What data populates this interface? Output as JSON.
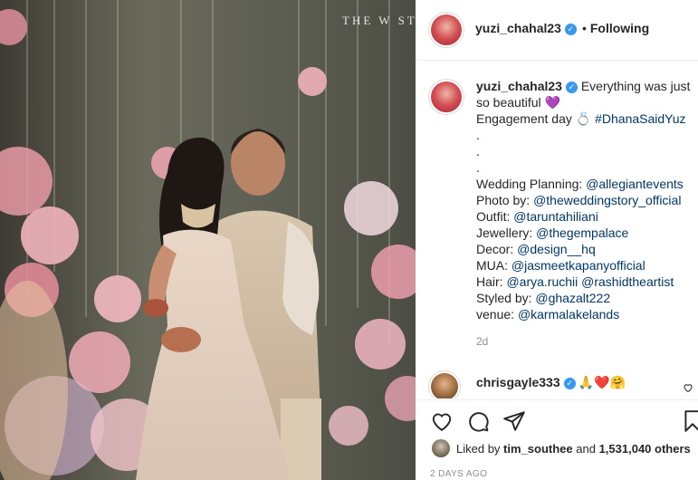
{
  "header": {
    "username": "yuzi_chahal23",
    "follow_label": "Following"
  },
  "watermark": "THE W ST",
  "caption": {
    "username": "yuzi_chahal23",
    "lines": [
      "Everything was just",
      "so beautiful 💜",
      "Engagement day 💍 #DhanaSaidYuz",
      ".",
      ".",
      ".",
      "Wedding Planning: @allegiantevents",
      "Photo by: @theweddingstory_official",
      "Outfit: @taruntahiliani",
      "Jewellery: @thegempalace",
      "Decor: @design__hq",
      "MUA: @jasmeetkapanyofficial",
      "Hair: @arya.ruchii @rashidtheartist",
      "Styled by: @ghazalt222",
      "venue: @karmalakelands"
    ],
    "time_ago": "2d"
  },
  "comment": {
    "username": "chrisgayle333",
    "emojis": "🙏❤️🤗"
  },
  "likes": {
    "prefix": "Liked by",
    "user": "tim_southee",
    "joiner": "and",
    "count": "1,531,040 others"
  },
  "date": "2 DAYS AGO",
  "icons": [
    "heart-icon",
    "comment-icon",
    "share-icon",
    "bookmark-icon",
    "verified-icon"
  ],
  "colors": {
    "verified": "#3897f0",
    "link": "#00376b",
    "muted": "#8e8e8e"
  }
}
